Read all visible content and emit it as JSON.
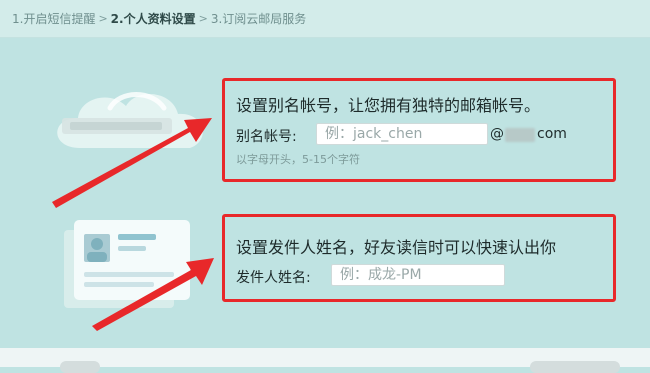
{
  "steps": [
    {
      "label": "1.开启短信提醒",
      "active": false
    },
    {
      "label": "2.个人资料设置",
      "active": true
    },
    {
      "label": "3.订阅云邮局服务",
      "active": false
    }
  ],
  "step_separator": ">",
  "alias": {
    "headline": "设置别名帐号，让您拥有独特的邮箱帐号。",
    "label": "别名帐号:",
    "placeholder": "例：jack_chen",
    "at_symbol": "@",
    "domain_suffix": "com",
    "hint": "以字母开头，5-15个字符"
  },
  "sender": {
    "headline": "设置发件人姓名，好友读信时可以快速认出你",
    "label": "发件人姓名:",
    "placeholder": "例：成龙-PM"
  },
  "colors": {
    "background": "#bfe3e2",
    "highlight_box": "#e8282a",
    "arrow": "#e8282a",
    "hint_text": "#7d9a99"
  },
  "icons": {
    "cloud_illustration": "cloud-icon",
    "card_illustration": "id-card-icon",
    "arrow": "red-arrow-icon"
  }
}
